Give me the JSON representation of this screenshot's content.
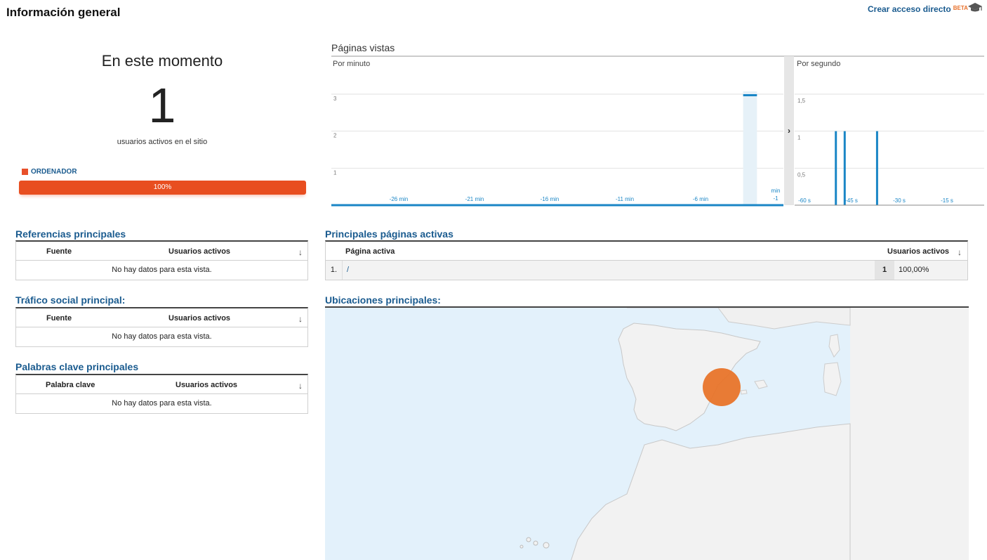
{
  "header": {
    "title": "Información general",
    "shortcut_label": "Crear acceso directo",
    "beta_label": "BETA",
    "icon": "graduation-cap-icon"
  },
  "right_now": {
    "title": "En este momento",
    "count": "1",
    "subtitle": "usuarios activos en el sitio",
    "legend_label": "ORDENADOR",
    "bar_label": "100%",
    "bar_fraction": 1.0,
    "accent": "#e8502a"
  },
  "referrals": {
    "title": "Referencias principales",
    "col1": "Fuente",
    "col2": "Usuarios activos",
    "empty": "No hay datos para esta vista."
  },
  "social": {
    "title": "Tráfico social principal:",
    "col1": "Fuente",
    "col2": "Usuarios activos",
    "empty": "No hay datos para esta vista."
  },
  "keywords": {
    "title": "Palabras clave principales",
    "col1": "Palabra clave",
    "col2": "Usuarios activos",
    "empty": "No hay datos para esta vista."
  },
  "pages": {
    "title": "Principales páginas activas",
    "col1": "Página activa",
    "col2": "Usuarios activos",
    "rows": [
      {
        "rank": "1.",
        "page": "/",
        "users": "1",
        "pct": "100,00%"
      }
    ]
  },
  "locations": {
    "title": "Ubicaciones principales:"
  },
  "chart_data": {
    "type": "bar",
    "title": "Páginas vistas",
    "panels": [
      {
        "name": "Por minuto",
        "ylim": [
          0,
          3
        ],
        "yticks": [
          "1",
          "2",
          "3"
        ],
        "xticks": [
          "-26 min",
          "-21 min",
          "-16 min",
          "-11 min",
          "-6 min"
        ],
        "last_tick": [
          "min",
          "-1"
        ],
        "values": [
          0,
          0,
          0,
          0,
          0,
          0,
          0,
          0,
          0,
          0,
          0,
          0,
          0,
          0,
          0,
          0,
          0,
          0,
          0,
          0,
          0,
          0,
          0,
          0,
          0,
          0,
          0,
          3,
          0
        ],
        "highlight_index": 27
      },
      {
        "name": "Por segundo",
        "ylim": [
          0,
          1.5
        ],
        "yticks": [
          "0,5",
          "1",
          "1,5"
        ],
        "xticks": [
          "-60 s",
          "-45 s",
          "-30 s",
          "-15 s"
        ],
        "spikes": [
          {
            "x": -48,
            "y": 1
          },
          {
            "x": -45,
            "y": 1
          },
          {
            "x": -34,
            "y": 1
          }
        ]
      }
    ],
    "color": "#1a86c6"
  }
}
